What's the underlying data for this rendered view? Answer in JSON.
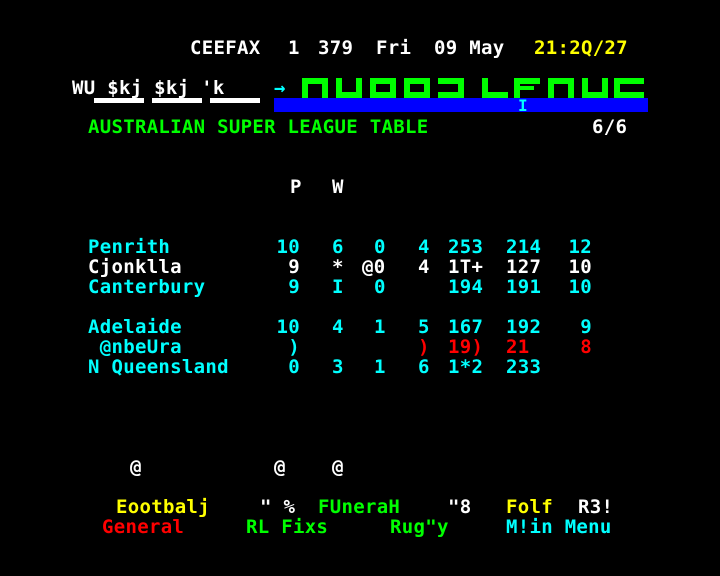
{
  "header": {
    "service": "CEEFAX",
    "channel": "1",
    "page": "379",
    "day": "Fri",
    "date": "09 May",
    "time": "21:2Q/27"
  },
  "section": {
    "left_glyphs": "WU $kj $kj 'k",
    "arrow": "→",
    "banner_text": "RUGBY LEAGUE"
  },
  "page_title": "AUSTRALIAN SUPER LEAGUE TABLE",
  "page_counter": "6/6",
  "column_headers": [
    "P",
    "W"
  ],
  "table_rows": [
    {
      "team": "Penrith",
      "p": "10",
      "w": "6",
      "d": "0",
      "l": "4",
      "f": "253",
      "a": "214",
      "pts": "12",
      "color": "#00ffff"
    },
    {
      "team": "Cjonklla",
      "p": "9",
      "w": "*",
      "d": "@0",
      "l": "4",
      "f": "1T+",
      "a": "127",
      "pts": "10",
      "color": "#ffffff"
    },
    {
      "team": "Canterbury",
      "p": "9",
      "w": "I",
      "d": "0",
      "l": "",
      "f": "194",
      "a": "191",
      "pts": "10",
      "color": "#00ffff"
    },
    {
      "team": "Adelaide",
      "p": "10",
      "w": "4",
      "d": "1",
      "l": "5",
      "f": "167",
      "a": "192",
      "pts": "9",
      "color": "#00ffff"
    },
    {
      "team": " @nbeUra",
      "p": ")",
      "w": "",
      "d": "",
      "l": ")",
      "f": "19)",
      "a": "21",
      "pts": "8",
      "color": "#00ffff",
      "tail_color": "#ff0000"
    },
    {
      "team": "N Queensland",
      "p": "0",
      "w": "3",
      "d": "1",
      "l": "6",
      "f": "1*2",
      "a": "233",
      "pts": "",
      "color": "#00ffff"
    }
  ],
  "footnote_glyphs": [
    "@",
    "@",
    "@"
  ],
  "fastext_row1": [
    {
      "label": "Eootbalj",
      "color": "#ffff00"
    },
    {
      "label": "\" %",
      "color": "#ffffff"
    },
    {
      "label": "FUneraH",
      "color": "#00ff00"
    },
    {
      "label": "\"8",
      "color": "#ffffff"
    },
    {
      "label": "Folf",
      "color": "#ffff00"
    },
    {
      "label": "R3!",
      "color": "#ffffff"
    }
  ],
  "fastext_row2": [
    {
      "label": "General",
      "color": "#ff0000"
    },
    {
      "label": "RL Fixs",
      "color": "#00ff00"
    },
    {
      "label": "Rug\"y",
      "color": "#00ff00"
    },
    {
      "label": "M!in Menu",
      "color": "#00ffff"
    }
  ]
}
